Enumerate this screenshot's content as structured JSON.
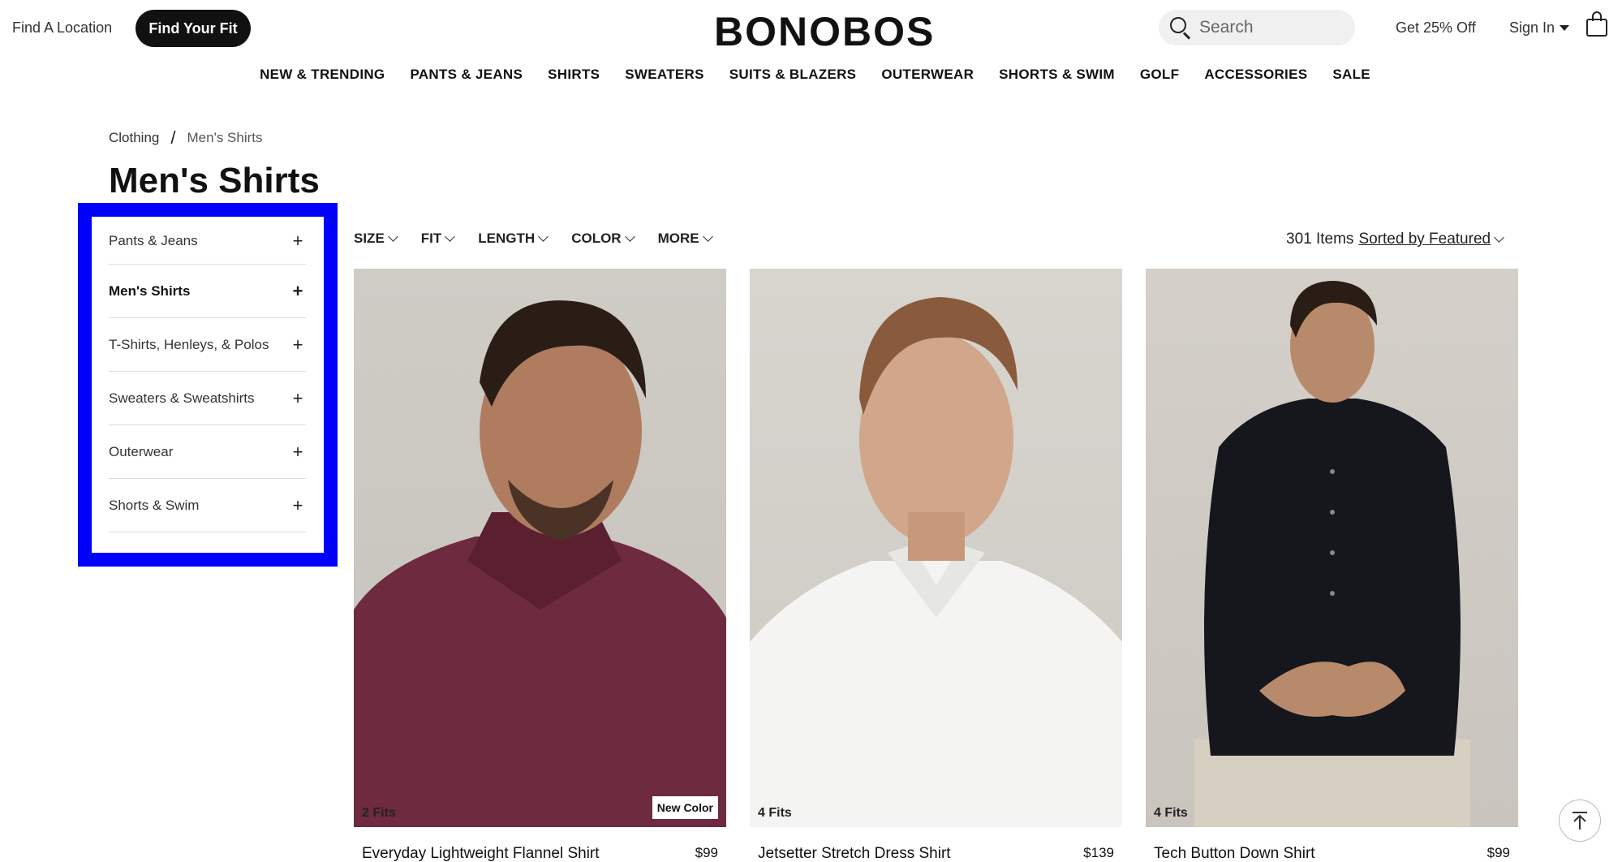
{
  "header": {
    "find_location": "Find A Location",
    "find_fit": "Find Your Fit",
    "logo": "BONOBOS",
    "search_placeholder": "Search",
    "promo": "Get 25% Off",
    "sign_in": "Sign In"
  },
  "nav": [
    "NEW & TRENDING",
    "PANTS & JEANS",
    "SHIRTS",
    "SWEATERS",
    "SUITS & BLAZERS",
    "OUTERWEAR",
    "SHORTS & SWIM",
    "GOLF",
    "ACCESSORIES",
    "SALE"
  ],
  "breadcrumb": {
    "parent": "Clothing",
    "separator": "/",
    "current": "Men's Shirts"
  },
  "page_title": "Men's Shirts",
  "sidebar": {
    "items": [
      {
        "label": "Pants & Jeans"
      },
      {
        "label": "Men's Shirts",
        "active": true
      },
      {
        "label": "T-Shirts, Henleys, & Polos"
      },
      {
        "label": "Sweaters & Sweatshirts"
      },
      {
        "label": "Outerwear"
      },
      {
        "label": "Shorts & Swim"
      }
    ],
    "highlight_color": "#0000ff"
  },
  "filters": [
    "SIZE",
    "FIT",
    "LENGTH",
    "COLOR",
    "MORE"
  ],
  "results": {
    "count": "301 Items",
    "sort": "Sorted by Featured"
  },
  "products": [
    {
      "name": "Everyday Lightweight Flannel Shirt",
      "price": "$99",
      "fits": "2 Fits",
      "badge": "New Color",
      "shirt_color": "#6e2a3e"
    },
    {
      "name": "Jetsetter Stretch Dress Shirt",
      "price": "$139",
      "fits": "4 Fits",
      "badge": "",
      "shirt_color": "#f4f4f2"
    },
    {
      "name": "Tech Button Down Shirt",
      "price": "$99",
      "fits": "4 Fits",
      "badge": "",
      "shirt_color": "#15171c"
    }
  ]
}
